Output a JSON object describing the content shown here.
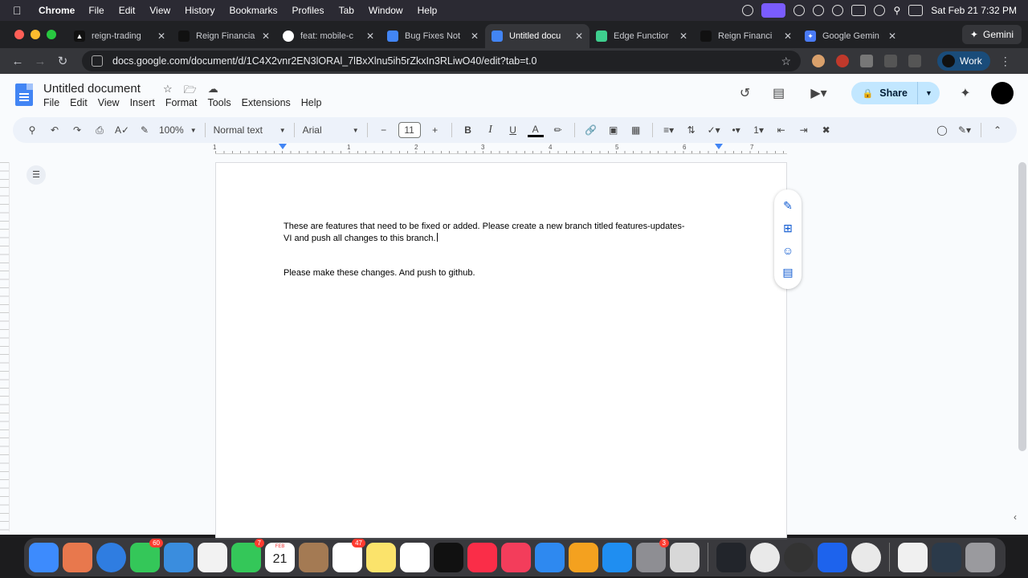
{
  "menubar": {
    "app": "Chrome",
    "items": [
      "File",
      "Edit",
      "View",
      "History",
      "Bookmarks",
      "Profiles",
      "Tab",
      "Window",
      "Help"
    ],
    "datetime": "Sat Feb 21  7:32 PM"
  },
  "tabs": [
    {
      "label": "reign-trading",
      "icon": "vercel-icon",
      "color": "#111111",
      "active": false
    },
    {
      "label": "Reign Financia",
      "icon": "app-icon",
      "color": "#111111",
      "active": false
    },
    {
      "label": "feat: mobile-c",
      "icon": "github-icon",
      "color": "#24292e",
      "active": false
    },
    {
      "label": "Bug Fixes Not",
      "icon": "docs-icon",
      "color": "#4285f4",
      "active": false
    },
    {
      "label": "Untitled docu",
      "icon": "docs-icon",
      "color": "#4285f4",
      "active": true
    },
    {
      "label": "Edge Functior",
      "icon": "supabase-icon",
      "color": "#3ecf8e",
      "active": false
    },
    {
      "label": "Reign Financi",
      "icon": "app-icon",
      "color": "#111111",
      "active": false
    },
    {
      "label": "Google Gemin",
      "icon": "gemini-icon",
      "color": "#4a7bf7",
      "active": false
    }
  ],
  "gemini_chip": "Gemini",
  "url": "docs.google.com/document/d/1C4X2vnr2EN3lORAl_7lBxXlnu5ih5rZkxIn3RLiwO40/edit?tab=t.0",
  "profile_chip": "Work",
  "doc": {
    "title": "Untitled document",
    "menu": [
      "File",
      "Edit",
      "View",
      "Insert",
      "Format",
      "Tools",
      "Extensions",
      "Help"
    ],
    "share_label": "Share",
    "toolbar": {
      "zoom": "100%",
      "style": "Normal text",
      "font": "Arial",
      "font_size": "11"
    },
    "ruler_labels": [
      "1",
      "1",
      "2",
      "3",
      "4",
      "5",
      "6",
      "7"
    ],
    "paragraphs": [
      "These are features that need to be fixed or added. Please create a new branch titled features-updates-VI and push all changes to this branch.",
      "Please make these changes. And push to github."
    ]
  },
  "dock": {
    "badges": {
      "messages": "60",
      "facetime": "7",
      "reminders": "47",
      "systemsettings": "3"
    },
    "calendar_month": "FEB",
    "calendar_day": "21"
  },
  "colors": {
    "accent": "#0b57d0",
    "share_bg": "#c2e7ff",
    "toolbar_bg": "#edf2fa",
    "chrome_dark": "#202124"
  }
}
